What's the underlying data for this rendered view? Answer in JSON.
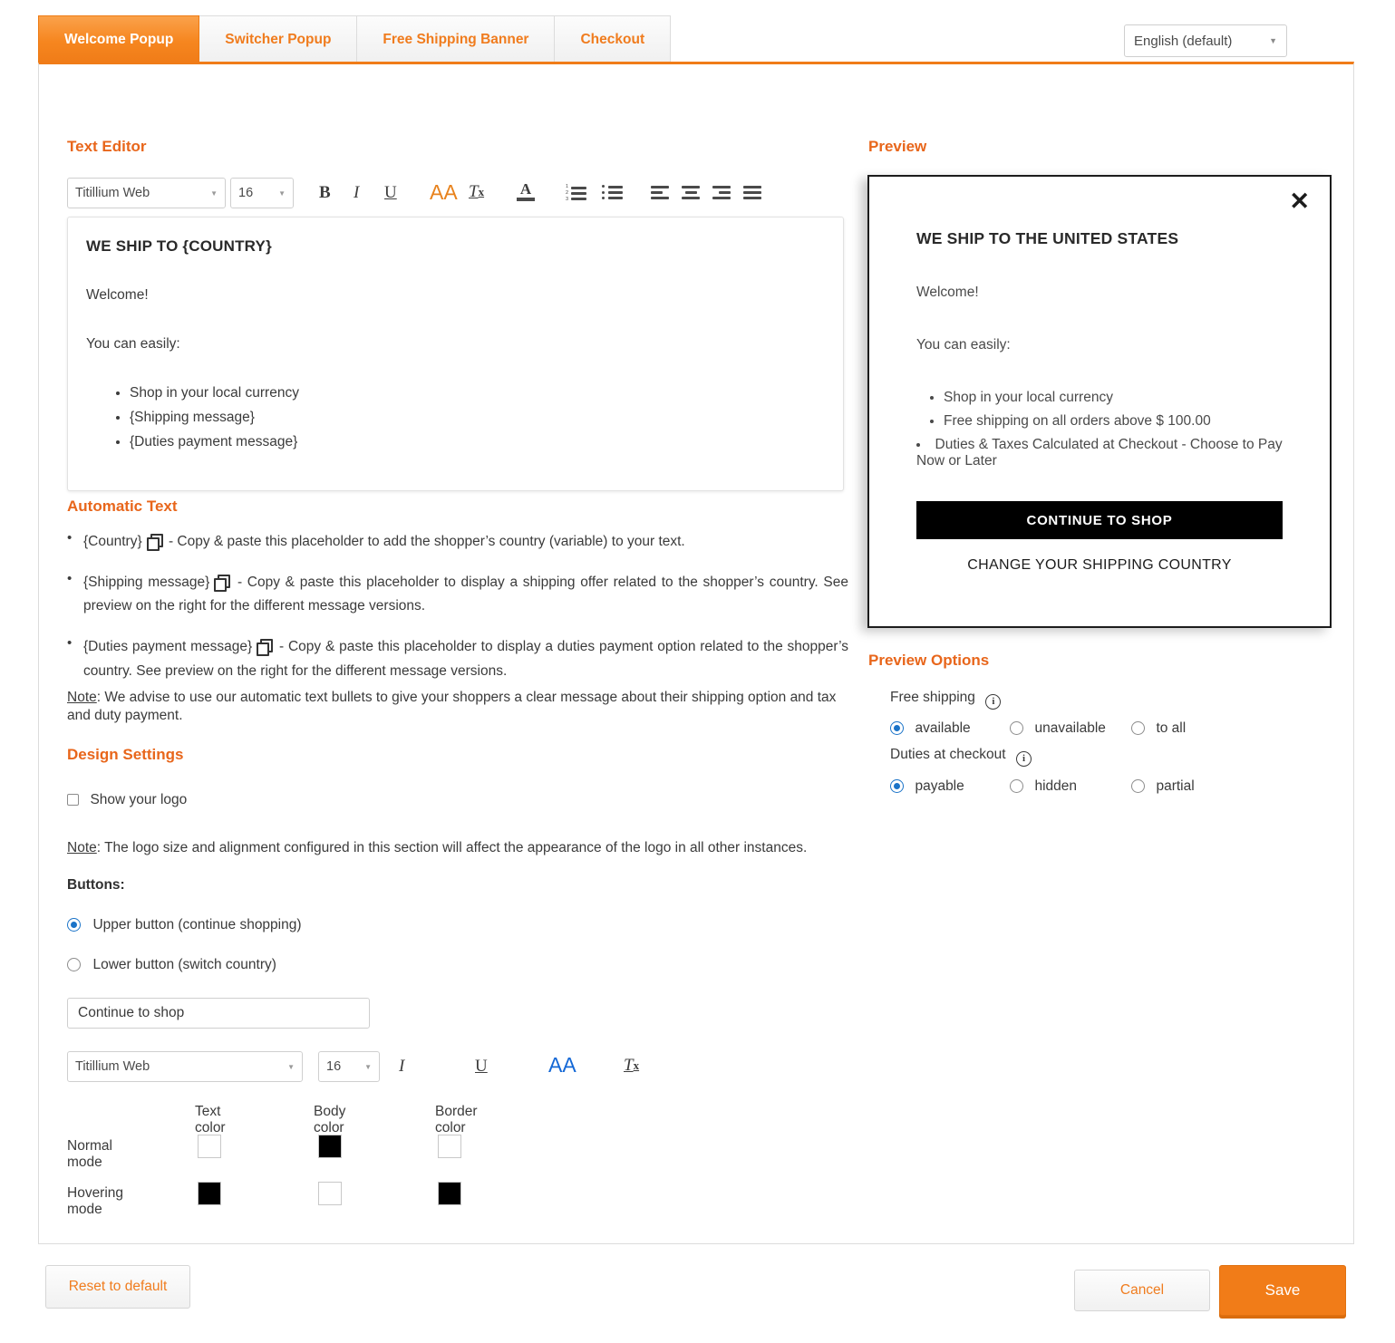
{
  "tabs": [
    {
      "label": "Welcome Popup",
      "active": true
    },
    {
      "label": "Switcher Popup",
      "active": false
    },
    {
      "label": "Free Shipping Banner",
      "active": false
    },
    {
      "label": "Checkout",
      "active": false
    }
  ],
  "language_select": {
    "value": "English (default)",
    "caret": "chevron-down-icon"
  },
  "sections": {
    "text_editor": "Text Editor",
    "automatic_text": "Automatic Text",
    "design_settings": "Design Settings",
    "preview": "Preview",
    "preview_options": "Preview Options"
  },
  "editor_toolbar": {
    "font_family": "Titillium Web",
    "font_size": "16",
    "buttons": [
      {
        "name": "bold",
        "glyph": "B"
      },
      {
        "name": "italic",
        "glyph": "I"
      },
      {
        "name": "underline",
        "glyph": "U"
      },
      {
        "name": "font-color-size",
        "glyph": "AA",
        "color": "#e8821c"
      },
      {
        "name": "clear-formatting",
        "glyph": "T"
      },
      {
        "name": "text-color",
        "glyph": "A"
      },
      {
        "name": "ordered-list",
        "glyph": ""
      },
      {
        "name": "unordered-list",
        "glyph": ""
      },
      {
        "name": "align-left",
        "glyph": ""
      },
      {
        "name": "align-center",
        "glyph": ""
      },
      {
        "name": "align-right",
        "glyph": ""
      },
      {
        "name": "align-justify",
        "glyph": ""
      }
    ]
  },
  "editor_content": {
    "title": "WE SHIP TO {COUNTRY}",
    "paragraph1": "Welcome!",
    "paragraph2": "You can easily:",
    "bullets": [
      "Shop in your local currency",
      "{Shipping message}",
      "{Duties payment message}"
    ]
  },
  "automatic_text": {
    "items": [
      {
        "placeholder": "{Country}",
        "icon": "copy-icon",
        "description": " - Copy & paste this placeholder to add the shopper’s country (variable) to your text."
      },
      {
        "placeholder": "{Shipping message}",
        "icon": "copy-icon",
        "description": " - Copy & paste this placeholder to display a shipping offer related to the shopper’s country. See preview on the right for the different message versions."
      },
      {
        "placeholder": "{Duties payment message}",
        "icon": "copy-icon",
        "description": " - Copy & paste this placeholder to display a duties payment option related to the shopper’s country. See preview on the right for the different message versions."
      }
    ],
    "note_label": "Note",
    "note_text": ": We advise to use our automatic text bullets to give your shoppers a clear message about their shipping option and tax and duty payment."
  },
  "design_settings": {
    "show_logo": {
      "label": "Show your logo",
      "checked": false
    },
    "note_label": "Note",
    "note_text": ": The logo size and alignment configured in this section will affect the appearance of the logo in all other instances.",
    "buttons_label": "Buttons:",
    "button_radios": [
      {
        "label": "Upper button (continue shopping)",
        "selected": true
      },
      {
        "label": "Lower button (switch country)",
        "selected": false
      }
    ],
    "button_text_value": "Continue to shop",
    "button_toolbar": {
      "font_family": "Titillium Web",
      "font_size": "16",
      "buttons": [
        {
          "name": "italic",
          "glyph": "I",
          "color": "#3d3d3d"
        },
        {
          "name": "underline",
          "glyph": "U",
          "color": "#3d3d3d"
        },
        {
          "name": "font-color-size",
          "glyph": "AA",
          "color": "#1468d6"
        },
        {
          "name": "clear-formatting",
          "glyph": "T",
          "color": "#3d3d3d"
        }
      ]
    },
    "color_table": {
      "columns": [
        "Text color",
        "Body color",
        "Border color"
      ],
      "rows": [
        {
          "label": "Normal mode",
          "colors": [
            "#ffffff",
            "#000000",
            "#ffffff"
          ]
        },
        {
          "label": "Hovering mode",
          "colors": [
            "#000000",
            "#ffffff",
            "#000000"
          ]
        }
      ]
    }
  },
  "preview_popup": {
    "close_icon": "close-icon",
    "title": "WE SHIP TO THE UNITED STATES",
    "paragraph1": "Welcome!",
    "paragraph2": "You can easily:",
    "bullets": [
      "Shop in your local currency",
      "Free shipping on all orders above $ 100.00",
      "Duties & Taxes Calculated at Checkout - Choose to Pay Now or Later"
    ],
    "primary_button": "CONTINUE TO SHOP",
    "secondary_link": "CHANGE YOUR SHIPPING COUNTRY",
    "primary_button_bg": "#000000",
    "primary_button_color": "#ffffff"
  },
  "preview_options": {
    "groups": [
      {
        "label": "Free shipping",
        "info_icon": "info-icon",
        "options": [
          {
            "label": "available",
            "selected": true
          },
          {
            "label": "unavailable",
            "selected": false
          },
          {
            "label": "to all",
            "selected": false
          }
        ]
      },
      {
        "label": "Duties at checkout",
        "info_icon": "info-icon",
        "options": [
          {
            "label": "payable",
            "selected": true
          },
          {
            "label": "hidden",
            "selected": false
          },
          {
            "label": "partial",
            "selected": false
          }
        ]
      }
    ]
  },
  "footer": {
    "reset_label": "Reset to default",
    "cancel_label": "Cancel",
    "save_label": "Save"
  },
  "colors": {
    "accent": "#f07c18",
    "heading": "#e8661b",
    "radio_blue": "#1a73c8",
    "toolbar_blue": "#1468d6",
    "toolbar_orange": "#e8821c"
  }
}
